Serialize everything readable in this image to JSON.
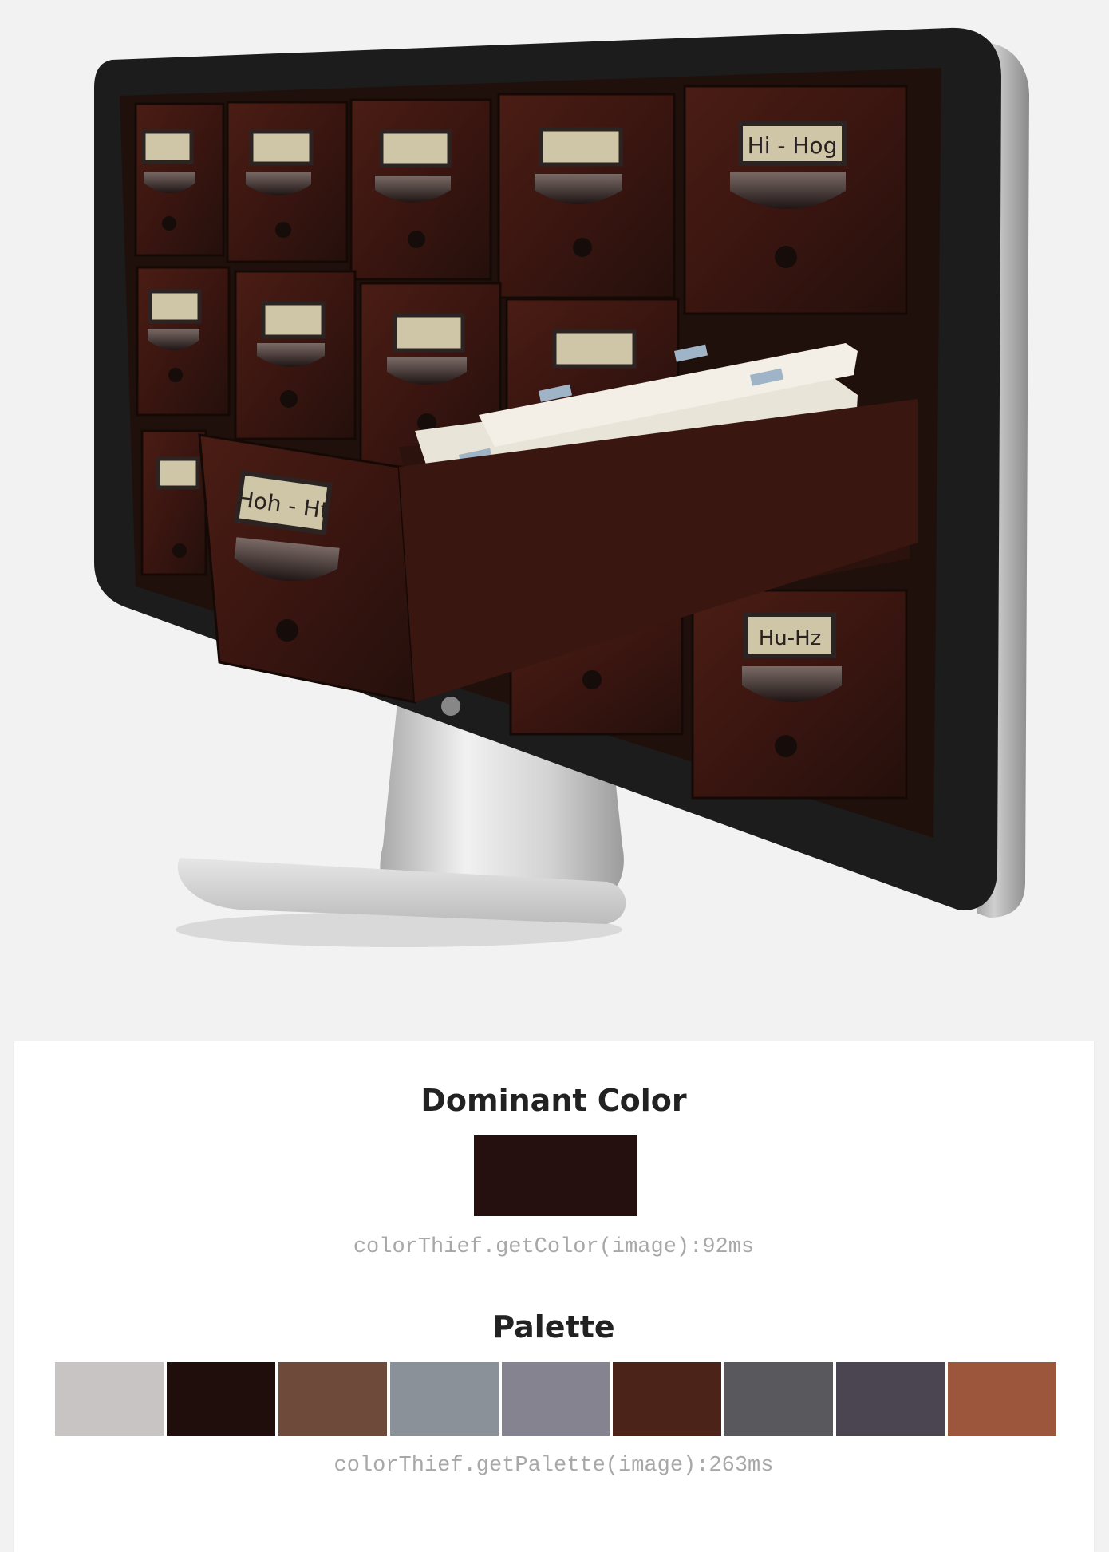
{
  "image": {
    "description_icon": "monitor-card-catalog-image",
    "drawer_labels": [
      "Hi - Hog",
      "Hoh - Ht",
      "Hu-Hz"
    ],
    "colors": {
      "wood": "#3a1510",
      "wood_dark": "#21100d",
      "bezel": "#1c1c1c",
      "stand": "#d6d6d6",
      "cards": "#e9e4d8",
      "label_plate": "#cfc6a8"
    }
  },
  "dominant": {
    "title": "Dominant Color",
    "color": "#26100f",
    "code_text": "colorThief.getColor(image):92ms"
  },
  "palette": {
    "title": "Palette",
    "colors": [
      "#c8c4c4",
      "#200e0d",
      "#6e4a3b",
      "#8b9198",
      "#858390",
      "#4c2319",
      "#59595d",
      "#4b4451",
      "#9b563b"
    ],
    "code_text": "colorThief.getPalette(image):263ms"
  }
}
